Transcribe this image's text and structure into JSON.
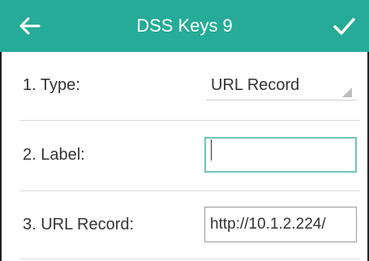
{
  "header": {
    "title": "DSS Keys 9",
    "back_icon": "back-arrow-icon",
    "confirm_icon": "checkmark-icon",
    "background_color": "#26ab98"
  },
  "fields": [
    {
      "label": "1. Type:",
      "control": "select",
      "value": "URL Record"
    },
    {
      "label": "2. Label:",
      "control": "text",
      "value": ""
    },
    {
      "label": "3. URL Record:",
      "control": "text",
      "value": "http://10.1.2.224/"
    }
  ]
}
